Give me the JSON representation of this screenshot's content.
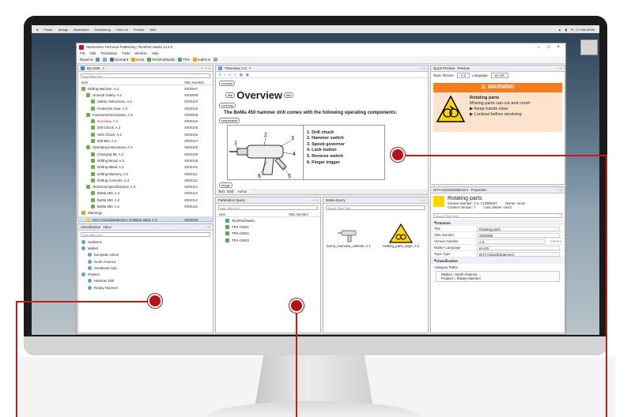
{
  "mac": {
    "menu": [
      "Finder",
      "Ablage",
      "Bearbeiten",
      "Darstellung",
      "Gehe zu",
      "Fenster",
      "Hilfe"
    ],
    "clock": "Fr. 17. Mai 09:50"
  },
  "window": {
    "title": "Namsoerter Technical Publishing | TechPub Studio 14.2.0",
    "menu": [
      "File",
      "Edit",
      "Translation",
      "Tools",
      "Window",
      "Help"
    ]
  },
  "toolbar": {
    "report": "Report",
    "normal": "Normal",
    "cms2": "cms2",
    "techpubstudio": "TechPubStudio",
    "tps": "TPS",
    "author": "Author"
  },
  "mycms": {
    "tab": "My CMS",
    "filter_placeholder": "type filter text",
    "col_item": "Item",
    "col_xml": "XML Number",
    "rows": [
      {
        "label": "Drilling Machine, A.2",
        "xml": "X000097",
        "red": false
      },
      {
        "label": "General Safety, A.2",
        "xml": "X000098",
        "red": false
      },
      {
        "label": "Safety Instructions, A.2",
        "xml": "X000103",
        "red": false
      },
      {
        "label": "Protective Gear, A.2",
        "xml": "X000104",
        "red": false
      },
      {
        "label": "Functional Description, A.2",
        "xml": "X000099",
        "red": false
      },
      {
        "label": "Overview, A.2",
        "xml": "X000104",
        "red": true
      },
      {
        "label": "Drill Chuck, A.2",
        "xml": "X000105",
        "red": false
      },
      {
        "label": "SDS Chuck, A.2",
        "xml": "X000106",
        "red": false
      },
      {
        "label": "Drill Bits, A.2",
        "xml": "X000107",
        "red": false
      },
      {
        "label": "Operating Instructions, A.2",
        "xml": "X000100",
        "red": false
      },
      {
        "label": "Changing Bit, A.2",
        "xml": "X000108",
        "red": false
      },
      {
        "label": "Drilling Wood, A.2",
        "xml": "X000109",
        "red": false
      },
      {
        "label": "Drilling Metal, A.2",
        "xml": "X000110",
        "red": false
      },
      {
        "label": "Drilling Masonry, A.2",
        "xml": "X000111",
        "red": false
      },
      {
        "label": "Drilling Concrete, A.2",
        "xml": "X000112",
        "red": false
      },
      {
        "label": "Technical Specifications, A.2",
        "xml": "X000101",
        "red": false
      },
      {
        "label": "BoMa 250, A.2",
        "xml": "X000113",
        "red": false
      },
      {
        "label": "BoMa 450, A.2",
        "xml": "X000114",
        "red": false
      },
      {
        "label": "BoMa 650, A.2",
        "xml": "X000115",
        "red": false
      },
      {
        "label": "Warnings",
        "xml": "",
        "red": false
      },
      {
        "label": "DITA HazardStatement_Rotating parts, A.2",
        "xml": "X000286",
        "red": false
      }
    ]
  },
  "editor": {
    "tab": "*Overview, A.2",
    "concept": "concept",
    "title": "Overview",
    "title_tag": "title",
    "conbody": "conbody",
    "intro": "The ",
    "product": "BoMa 450",
    "intro_rest": " hammer drill comes with the following operating components:",
    "steps": [
      "1. Drill chuck",
      "2. Hammer switch",
      "3. Speed governor",
      "4. Lock button",
      "5. Reverse switch",
      "6. Finger trigger"
    ],
    "tags": [
      "image",
      "simpletable",
      "conbody",
      "concept"
    ],
    "bottom_tabs": [
      "Text",
      "Grid",
      "Author"
    ]
  },
  "preview": {
    "tab_quick": "Quick Preview",
    "tab_preview": "Preview",
    "topic_version_label": "Topic Version:",
    "topic_version": "A.2",
    "language_label": "Language:",
    "language": "en-US",
    "warning_title": "WARNING",
    "warning_heading": "Rotating parts",
    "warning_line1": "Moving parts can cut and crush",
    "warning_line2": "Keep hands clear",
    "warning_line3": "Lockout before servicing"
  },
  "properties": {
    "tab": "DITA HazardStatement - Properties",
    "heading": "Rotating parts",
    "version_number": "Version Number: A.2, CURRENT",
    "content_version": "Content Version: 7",
    "owner": "Owner: cms2",
    "lock_owner": "Lock Owner: cms2",
    "filter_placeholder": "Insert Filter Text",
    "common": "Common",
    "fields": [
      {
        "label": "Title",
        "value": "Rotating parts"
      },
      {
        "label": "XML Number",
        "value": "X000286"
      },
      {
        "label": "Version Number",
        "value": "A.2"
      },
      {
        "label": "Master Language",
        "value": "en-US"
      },
      {
        "label": "Topic Type",
        "value": "DITA HazardStatement"
      }
    ],
    "current": "Current",
    "classification": "Classification",
    "category_paths": "Category Paths",
    "paths": [
      "Market = North America",
      "Product = Rotary Hammer"
    ]
  },
  "classification": {
    "tab": "Classification",
    "tab2": "Inbox",
    "filter_placeholder": "type filter text",
    "rows": [
      "Audience",
      "Market",
      "European Union",
      "North America",
      "Southeast Asia",
      "Product",
      "Hammer Drill",
      "Rotary Hammer"
    ]
  },
  "publication": {
    "tab": "Publication Query",
    "filter_placeholder": "type filter text",
    "col_item": "Item",
    "col_xml": "XML Number",
    "rows": [
      "TechPubStudio",
      "TPS-CMS1",
      "TPS-CMS2",
      "TPS-CMS3"
    ]
  },
  "media": {
    "tab": "Media Query",
    "filter_placeholder": "Insert Filter Text",
    "items": [
      "boma_overview_callouts, A.1",
      "rotating_parts_large, A.2"
    ]
  }
}
